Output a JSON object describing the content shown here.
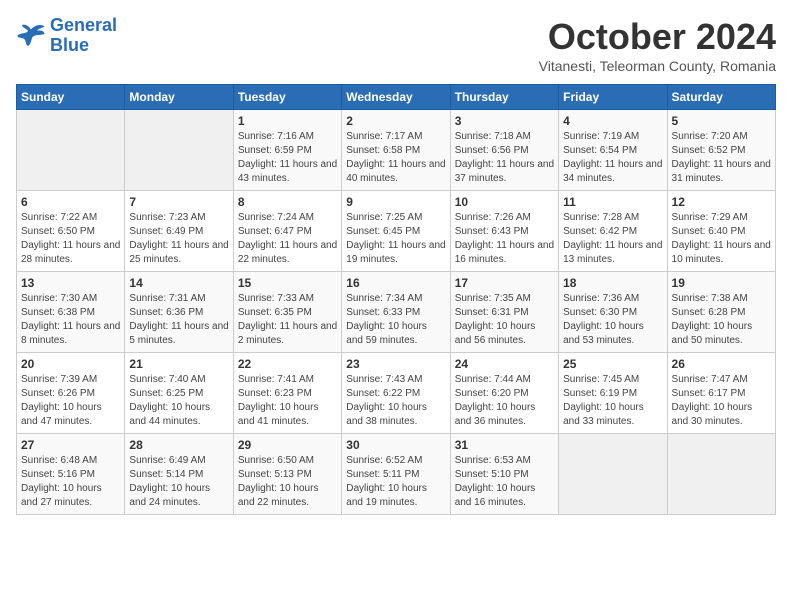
{
  "header": {
    "logo_line1": "General",
    "logo_line2": "Blue",
    "month_title": "October 2024",
    "location": "Vitanesti, Teleorman County, Romania"
  },
  "weekdays": [
    "Sunday",
    "Monday",
    "Tuesday",
    "Wednesday",
    "Thursday",
    "Friday",
    "Saturday"
  ],
  "weeks": [
    [
      {
        "day": "",
        "sunrise": "",
        "sunset": "",
        "daylight": ""
      },
      {
        "day": "",
        "sunrise": "",
        "sunset": "",
        "daylight": ""
      },
      {
        "day": "1",
        "sunrise": "Sunrise: 7:16 AM",
        "sunset": "Sunset: 6:59 PM",
        "daylight": "Daylight: 11 hours and 43 minutes."
      },
      {
        "day": "2",
        "sunrise": "Sunrise: 7:17 AM",
        "sunset": "Sunset: 6:58 PM",
        "daylight": "Daylight: 11 hours and 40 minutes."
      },
      {
        "day": "3",
        "sunrise": "Sunrise: 7:18 AM",
        "sunset": "Sunset: 6:56 PM",
        "daylight": "Daylight: 11 hours and 37 minutes."
      },
      {
        "day": "4",
        "sunrise": "Sunrise: 7:19 AM",
        "sunset": "Sunset: 6:54 PM",
        "daylight": "Daylight: 11 hours and 34 minutes."
      },
      {
        "day": "5",
        "sunrise": "Sunrise: 7:20 AM",
        "sunset": "Sunset: 6:52 PM",
        "daylight": "Daylight: 11 hours and 31 minutes."
      }
    ],
    [
      {
        "day": "6",
        "sunrise": "Sunrise: 7:22 AM",
        "sunset": "Sunset: 6:50 PM",
        "daylight": "Daylight: 11 hours and 28 minutes."
      },
      {
        "day": "7",
        "sunrise": "Sunrise: 7:23 AM",
        "sunset": "Sunset: 6:49 PM",
        "daylight": "Daylight: 11 hours and 25 minutes."
      },
      {
        "day": "8",
        "sunrise": "Sunrise: 7:24 AM",
        "sunset": "Sunset: 6:47 PM",
        "daylight": "Daylight: 11 hours and 22 minutes."
      },
      {
        "day": "9",
        "sunrise": "Sunrise: 7:25 AM",
        "sunset": "Sunset: 6:45 PM",
        "daylight": "Daylight: 11 hours and 19 minutes."
      },
      {
        "day": "10",
        "sunrise": "Sunrise: 7:26 AM",
        "sunset": "Sunset: 6:43 PM",
        "daylight": "Daylight: 11 hours and 16 minutes."
      },
      {
        "day": "11",
        "sunrise": "Sunrise: 7:28 AM",
        "sunset": "Sunset: 6:42 PM",
        "daylight": "Daylight: 11 hours and 13 minutes."
      },
      {
        "day": "12",
        "sunrise": "Sunrise: 7:29 AM",
        "sunset": "Sunset: 6:40 PM",
        "daylight": "Daylight: 11 hours and 10 minutes."
      }
    ],
    [
      {
        "day": "13",
        "sunrise": "Sunrise: 7:30 AM",
        "sunset": "Sunset: 6:38 PM",
        "daylight": "Daylight: 11 hours and 8 minutes."
      },
      {
        "day": "14",
        "sunrise": "Sunrise: 7:31 AM",
        "sunset": "Sunset: 6:36 PM",
        "daylight": "Daylight: 11 hours and 5 minutes."
      },
      {
        "day": "15",
        "sunrise": "Sunrise: 7:33 AM",
        "sunset": "Sunset: 6:35 PM",
        "daylight": "Daylight: 11 hours and 2 minutes."
      },
      {
        "day": "16",
        "sunrise": "Sunrise: 7:34 AM",
        "sunset": "Sunset: 6:33 PM",
        "daylight": "Daylight: 10 hours and 59 minutes."
      },
      {
        "day": "17",
        "sunrise": "Sunrise: 7:35 AM",
        "sunset": "Sunset: 6:31 PM",
        "daylight": "Daylight: 10 hours and 56 minutes."
      },
      {
        "day": "18",
        "sunrise": "Sunrise: 7:36 AM",
        "sunset": "Sunset: 6:30 PM",
        "daylight": "Daylight: 10 hours and 53 minutes."
      },
      {
        "day": "19",
        "sunrise": "Sunrise: 7:38 AM",
        "sunset": "Sunset: 6:28 PM",
        "daylight": "Daylight: 10 hours and 50 minutes."
      }
    ],
    [
      {
        "day": "20",
        "sunrise": "Sunrise: 7:39 AM",
        "sunset": "Sunset: 6:26 PM",
        "daylight": "Daylight: 10 hours and 47 minutes."
      },
      {
        "day": "21",
        "sunrise": "Sunrise: 7:40 AM",
        "sunset": "Sunset: 6:25 PM",
        "daylight": "Daylight: 10 hours and 44 minutes."
      },
      {
        "day": "22",
        "sunrise": "Sunrise: 7:41 AM",
        "sunset": "Sunset: 6:23 PM",
        "daylight": "Daylight: 10 hours and 41 minutes."
      },
      {
        "day": "23",
        "sunrise": "Sunrise: 7:43 AM",
        "sunset": "Sunset: 6:22 PM",
        "daylight": "Daylight: 10 hours and 38 minutes."
      },
      {
        "day": "24",
        "sunrise": "Sunrise: 7:44 AM",
        "sunset": "Sunset: 6:20 PM",
        "daylight": "Daylight: 10 hours and 36 minutes."
      },
      {
        "day": "25",
        "sunrise": "Sunrise: 7:45 AM",
        "sunset": "Sunset: 6:19 PM",
        "daylight": "Daylight: 10 hours and 33 minutes."
      },
      {
        "day": "26",
        "sunrise": "Sunrise: 7:47 AM",
        "sunset": "Sunset: 6:17 PM",
        "daylight": "Daylight: 10 hours and 30 minutes."
      }
    ],
    [
      {
        "day": "27",
        "sunrise": "Sunrise: 6:48 AM",
        "sunset": "Sunset: 5:16 PM",
        "daylight": "Daylight: 10 hours and 27 minutes."
      },
      {
        "day": "28",
        "sunrise": "Sunrise: 6:49 AM",
        "sunset": "Sunset: 5:14 PM",
        "daylight": "Daylight: 10 hours and 24 minutes."
      },
      {
        "day": "29",
        "sunrise": "Sunrise: 6:50 AM",
        "sunset": "Sunset: 5:13 PM",
        "daylight": "Daylight: 10 hours and 22 minutes."
      },
      {
        "day": "30",
        "sunrise": "Sunrise: 6:52 AM",
        "sunset": "Sunset: 5:11 PM",
        "daylight": "Daylight: 10 hours and 19 minutes."
      },
      {
        "day": "31",
        "sunrise": "Sunrise: 6:53 AM",
        "sunset": "Sunset: 5:10 PM",
        "daylight": "Daylight: 10 hours and 16 minutes."
      },
      {
        "day": "",
        "sunrise": "",
        "sunset": "",
        "daylight": ""
      },
      {
        "day": "",
        "sunrise": "",
        "sunset": "",
        "daylight": ""
      }
    ]
  ]
}
